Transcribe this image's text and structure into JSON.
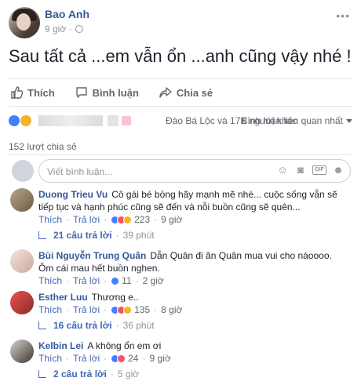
{
  "post": {
    "author": "Bao Anh",
    "time": "9 giờ",
    "privacy_icon": "globe-icon",
    "text": "Sau tất cả ...em vẫn ổn ...anh cũng vậy nhé !"
  },
  "actions": {
    "like": "Thích",
    "comment": "Bình luận",
    "share": "Chia sẻ"
  },
  "reactions": {
    "reactors": "Đào Bá Lộc và 17K người khác",
    "sort": "Bình luận liên quan nhất"
  },
  "shares": "152 lượt chia sẻ",
  "composer": {
    "placeholder": "Viết bình luận..."
  },
  "comments": [
    {
      "name": "Duong Trieu Vu",
      "text": "Cô gái bé bỏng hãy mạnh mẽ nhé... cuộc sống vẫn sẽ tiếp tục và hạnh phúc cũng sẽ đến và nỗi buồn cũng sẽ quên...",
      "like_label": "Thích",
      "reply_label": "Trả lời",
      "reaction_count": "223",
      "time": "9 giờ",
      "replies": "21 câu trả lời",
      "replies_time": "39 phút"
    },
    {
      "name": "Bùi Nguyễn Trung Quân",
      "text": "Dẫn Quân đi ăn Quân mua vui cho nàoooo. Ôm cái mau hết buồn nghen.",
      "like_label": "Thích",
      "reply_label": "Trả lời",
      "reaction_count": "11",
      "time": "2 giờ"
    },
    {
      "name": "Esther Luu",
      "text": "Thương e..",
      "like_label": "Thích",
      "reply_label": "Trả lời",
      "reaction_count": "135",
      "time": "8 giờ",
      "replies": "16 câu trả lời",
      "replies_time": "36 phút"
    },
    {
      "name": "Kelbin Lei",
      "text": "A không ổn em ơi",
      "like_label": "Thích",
      "reply_label": "Trả lời",
      "reaction_count": "24",
      "time": "9 giờ",
      "replies": "2 câu trả lời",
      "replies_time": "5 giờ"
    }
  ],
  "colors": {
    "link": "#365899",
    "action_link": "#4267b2",
    "muted": "#90949c",
    "text": "#1d2129"
  }
}
